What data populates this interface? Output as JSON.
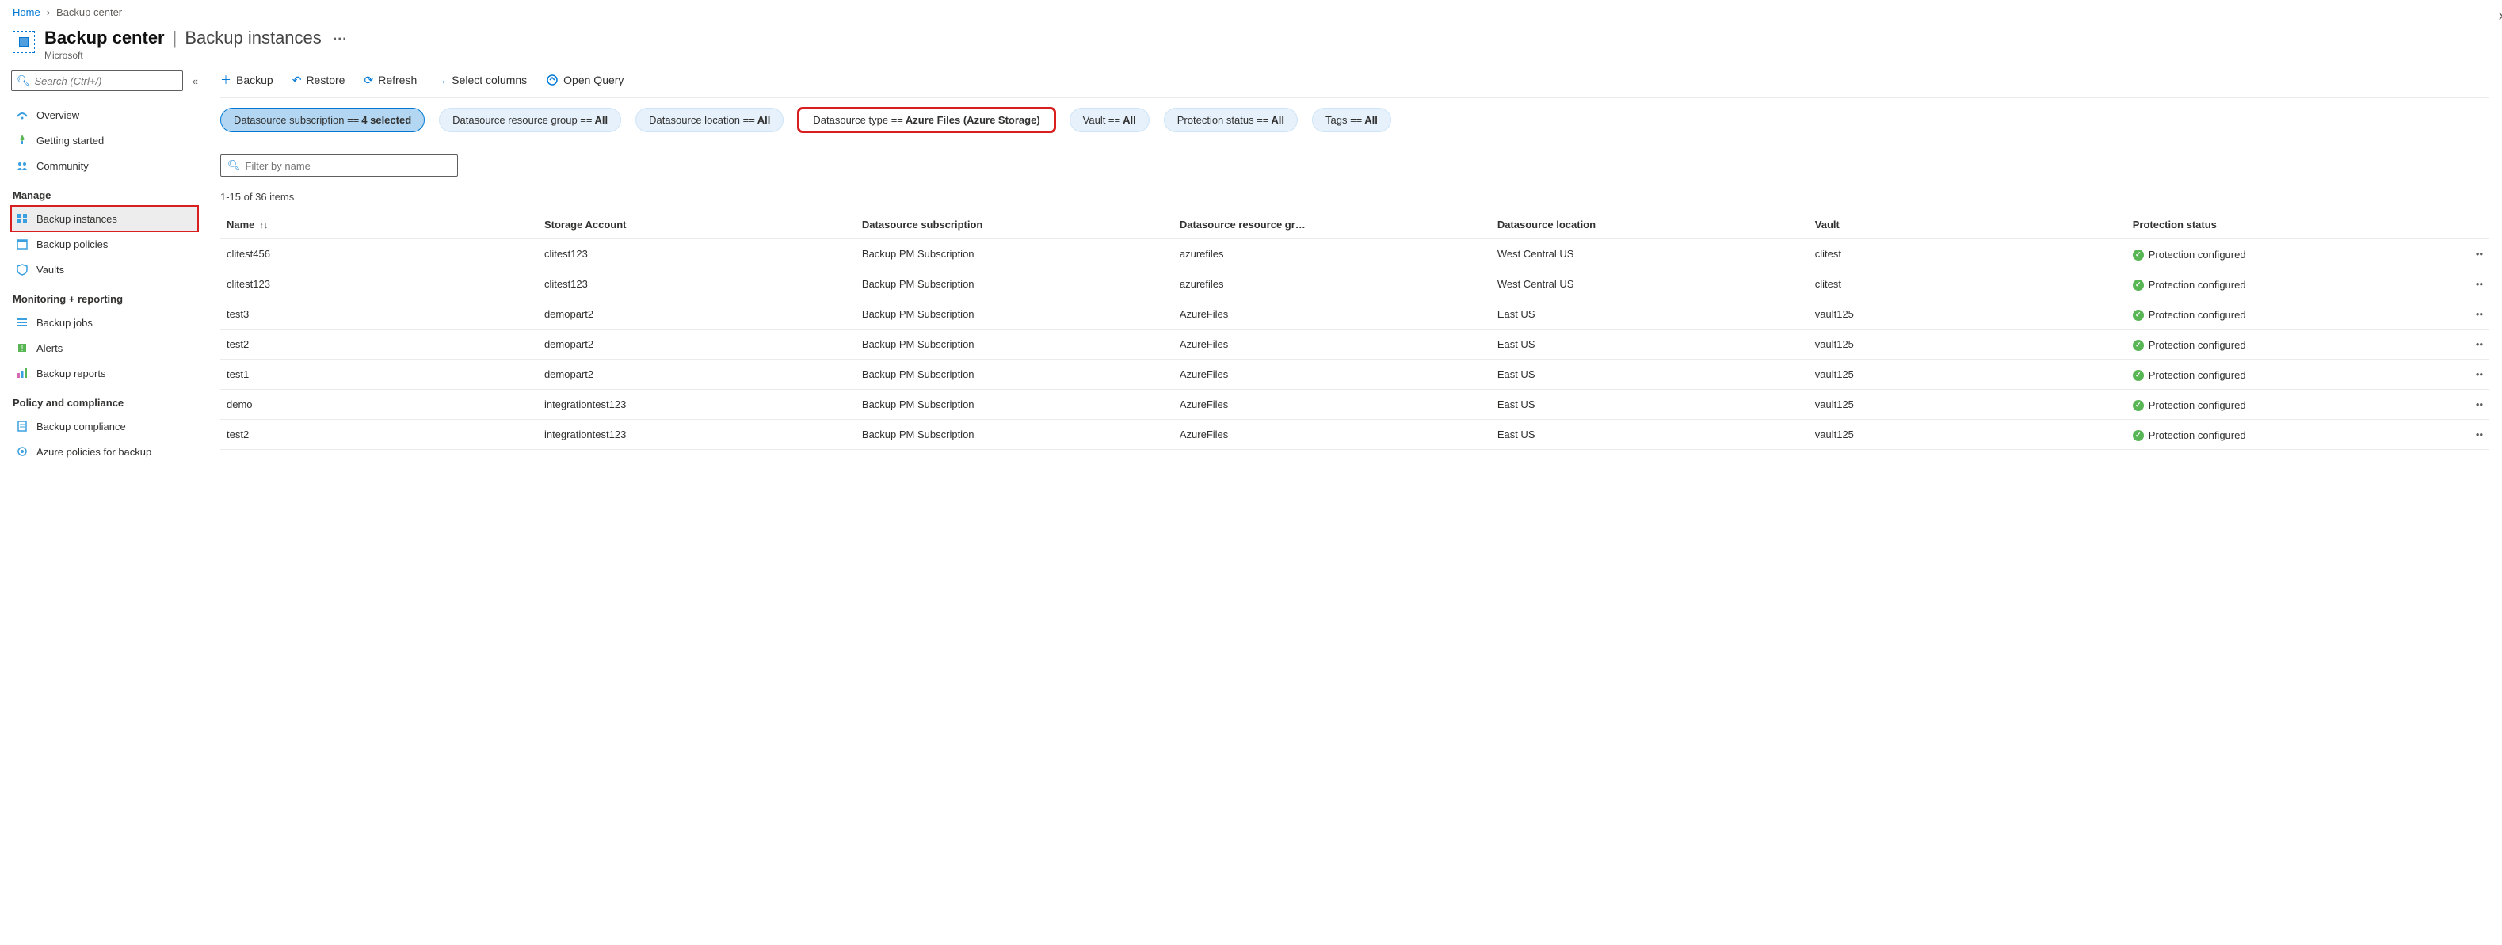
{
  "breadcrumb": {
    "home": "Home",
    "current": "Backup center"
  },
  "header": {
    "title": "Backup center",
    "subtitle_page": "Backup instances",
    "org": "Microsoft"
  },
  "sidebar": {
    "search_placeholder": "Search (Ctrl+/)",
    "items_top": [
      {
        "label": "Overview",
        "icon": "overview"
      },
      {
        "label": "Getting started",
        "icon": "rocket"
      },
      {
        "label": "Community",
        "icon": "people"
      }
    ],
    "section_manage": "Manage",
    "items_manage": [
      {
        "label": "Backup instances",
        "icon": "grid",
        "selected": true
      },
      {
        "label": "Backup policies",
        "icon": "calendar"
      },
      {
        "label": "Vaults",
        "icon": "vault"
      }
    ],
    "section_monitor": "Monitoring + reporting",
    "items_monitor": [
      {
        "label": "Backup jobs",
        "icon": "jobs"
      },
      {
        "label": "Alerts",
        "icon": "alert"
      },
      {
        "label": "Backup reports",
        "icon": "chart"
      }
    ],
    "section_policy": "Policy and compliance",
    "items_policy": [
      {
        "label": "Backup compliance",
        "icon": "doc"
      },
      {
        "label": "Azure policies for backup",
        "icon": "gear"
      }
    ]
  },
  "toolbar": {
    "backup": "Backup",
    "restore": "Restore",
    "refresh": "Refresh",
    "select_columns": "Select columns",
    "open_query": "Open Query"
  },
  "filters": {
    "subscription": {
      "prefix": "Datasource subscription == ",
      "value": "4 selected"
    },
    "rg": {
      "prefix": "Datasource resource group == ",
      "value": "All"
    },
    "location": {
      "prefix": "Datasource location == ",
      "value": "All"
    },
    "type": {
      "prefix": "Datasource type == ",
      "value": "Azure Files (Azure Storage)"
    },
    "vault": {
      "prefix": "Vault == ",
      "value": "All"
    },
    "protection": {
      "prefix": "Protection status == ",
      "value": "All"
    },
    "tags": {
      "prefix": "Tags == ",
      "value": "All"
    }
  },
  "filter_name_placeholder": "Filter by name",
  "count_line": "1-15 of 36 items",
  "columns": {
    "name": "Name",
    "storage": "Storage Account",
    "subscription": "Datasource subscription",
    "rg": "Datasource resource gr…",
    "location": "Datasource location",
    "vault": "Vault",
    "status": "Protection status"
  },
  "rows": [
    {
      "name": "clitest456",
      "storage": "clitest123",
      "subscription": "Backup PM Subscription",
      "rg": "azurefiles",
      "location": "West Central US",
      "vault": "clitest",
      "status": "Protection configured"
    },
    {
      "name": "clitest123",
      "storage": "clitest123",
      "subscription": "Backup PM Subscription",
      "rg": "azurefiles",
      "location": "West Central US",
      "vault": "clitest",
      "status": "Protection configured"
    },
    {
      "name": "test3",
      "storage": "demopart2",
      "subscription": "Backup PM Subscription",
      "rg": "AzureFiles",
      "location": "East US",
      "vault": "vault125",
      "status": "Protection configured"
    },
    {
      "name": "test2",
      "storage": "demopart2",
      "subscription": "Backup PM Subscription",
      "rg": "AzureFiles",
      "location": "East US",
      "vault": "vault125",
      "status": "Protection configured"
    },
    {
      "name": "test1",
      "storage": "demopart2",
      "subscription": "Backup PM Subscription",
      "rg": "AzureFiles",
      "location": "East US",
      "vault": "vault125",
      "status": "Protection configured"
    },
    {
      "name": "demo",
      "storage": "integrationtest123",
      "subscription": "Backup PM Subscription",
      "rg": "AzureFiles",
      "location": "East US",
      "vault": "vault125",
      "status": "Protection configured"
    },
    {
      "name": "test2",
      "storage": "integrationtest123",
      "subscription": "Backup PM Subscription",
      "rg": "AzureFiles",
      "location": "East US",
      "vault": "vault125",
      "status": "Protection configured"
    }
  ]
}
